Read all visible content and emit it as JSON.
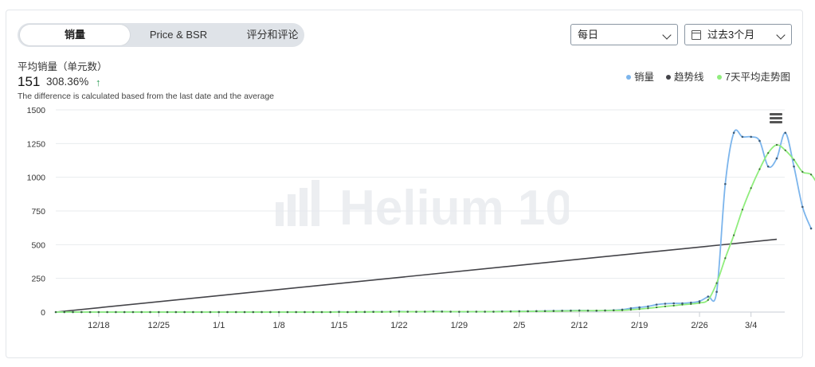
{
  "tabs": [
    {
      "label": "销量",
      "active": true
    },
    {
      "label": "Price & BSR",
      "active": false
    },
    {
      "label": "评分和评论",
      "active": false
    }
  ],
  "filters": {
    "interval": "每日",
    "range": "过去3个月"
  },
  "summary": {
    "label": "平均销量（单元数）",
    "value": "151",
    "change": "308.36%",
    "note": "The difference is calculated based from the last date and the average"
  },
  "legend": [
    {
      "label": "销量",
      "color": "#7cb5ec"
    },
    {
      "label": "趋势线",
      "color": "#434348"
    },
    {
      "label": "7天平均走势图",
      "color": "#90ed7d"
    }
  ],
  "watermark": "Helium 10",
  "colors": {
    "sales": "#7cb5ec",
    "trend": "#434348",
    "avg7": "#90ed7d"
  },
  "chart_data": {
    "type": "line",
    "x": [
      "12/13",
      "12/14",
      "12/15",
      "12/16",
      "12/17",
      "12/18",
      "12/19",
      "12/20",
      "12/21",
      "12/22",
      "12/23",
      "12/24",
      "12/25",
      "12/26",
      "12/27",
      "12/28",
      "12/29",
      "12/30",
      "12/31",
      "1/1",
      "1/2",
      "1/3",
      "1/4",
      "1/5",
      "1/6",
      "1/7",
      "1/8",
      "1/9",
      "1/10",
      "1/11",
      "1/12",
      "1/13",
      "1/14",
      "1/15",
      "1/16",
      "1/17",
      "1/18",
      "1/19",
      "1/20",
      "1/21",
      "1/22",
      "1/23",
      "1/24",
      "1/25",
      "1/26",
      "1/27",
      "1/28",
      "1/29",
      "1/30",
      "1/31",
      "2/1",
      "2/2",
      "2/3",
      "2/4",
      "2/5",
      "2/6",
      "2/7",
      "2/8",
      "2/9",
      "2/10",
      "2/11",
      "2/12",
      "2/13",
      "2/14",
      "2/15",
      "2/16",
      "2/17",
      "2/18",
      "2/19",
      "2/20",
      "2/21",
      "2/22",
      "2/23",
      "2/24",
      "2/25",
      "2/26",
      "2/27",
      "2/28",
      "3/1",
      "3/2",
      "3/3",
      "3/4",
      "3/5",
      "3/6",
      "3/7"
    ],
    "tick_labels": [
      "12/18",
      "12/25",
      "1/1",
      "1/8",
      "1/15",
      "1/22",
      "1/29",
      "2/5",
      "2/12",
      "2/19",
      "2/26",
      "3/4"
    ],
    "ylim": [
      0,
      1500
    ],
    "yticks": [
      0,
      250,
      500,
      750,
      1000,
      1250,
      1500
    ],
    "series": [
      {
        "name": "销量",
        "values": [
          0,
          0,
          0,
          0,
          0,
          0,
          0,
          0,
          0,
          0,
          0,
          0,
          0,
          0,
          0,
          0,
          0,
          0,
          0,
          0,
          0,
          0,
          0,
          0,
          0,
          0,
          0,
          0,
          0,
          0,
          0,
          0,
          0,
          2,
          0,
          1,
          1,
          2,
          2,
          2,
          4,
          3,
          2,
          3,
          5,
          4,
          3,
          2,
          2,
          3,
          3,
          3,
          5,
          5,
          6,
          6,
          7,
          8,
          9,
          10,
          11,
          12,
          11,
          10,
          12,
          14,
          18,
          28,
          35,
          42,
          55,
          62,
          65,
          65,
          70,
          80,
          115,
          150,
          950,
          1330,
          1300,
          1300,
          1270,
          1080,
          1140,
          1330,
          1080,
          780,
          620
        ]
      },
      {
        "name": "趋势线",
        "values_start": 0,
        "values_end": 540
      },
      {
        "name": "7天平均走势图",
        "values": [
          0,
          0,
          0,
          0,
          0,
          0,
          0,
          0,
          0,
          0,
          0,
          0,
          0,
          0,
          0,
          0,
          0,
          0,
          0,
          0,
          0,
          0,
          0,
          0,
          0,
          0,
          0,
          0,
          0,
          0,
          0,
          0,
          0,
          0,
          0,
          1,
          1,
          1,
          1,
          2,
          2,
          2,
          3,
          3,
          3,
          3,
          3,
          3,
          3,
          3,
          3,
          3,
          3,
          4,
          4,
          5,
          6,
          6,
          7,
          8,
          9,
          10,
          10,
          11,
          11,
          12,
          13,
          17,
          22,
          28,
          35,
          42,
          48,
          55,
          60,
          68,
          90,
          215,
          400,
          570,
          760,
          920,
          1060,
          1180,
          1240,
          1200,
          1130,
          1040,
          1020,
          920,
          810
        ]
      }
    ]
  }
}
